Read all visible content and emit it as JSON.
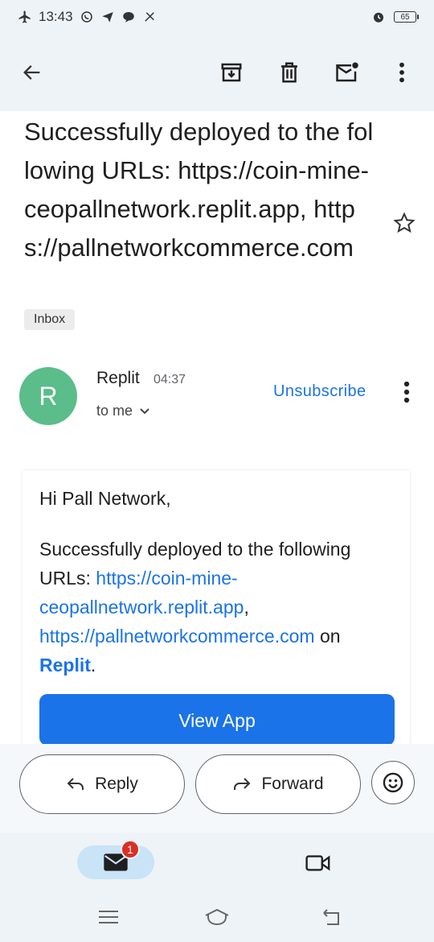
{
  "status_bar": {
    "time": "13:43",
    "battery": "65"
  },
  "toolbar": {
    "icons": [
      "back-arrow-icon",
      "archive-icon",
      "delete-icon",
      "mark-unread-icon",
      "more-vert-icon"
    ]
  },
  "email": {
    "subject": "Successfully deployed to the following URLs: https://coin-mine-ceopallnetwork.replit.app, https://pallnetworkcommerce.com",
    "label": "Inbox",
    "sender": {
      "initial": "R",
      "name": "Replit",
      "time": "04:37",
      "to": "to me"
    },
    "unsubscribe": "Unsubscribe",
    "body": {
      "greeting": "Hi Pall Network,",
      "text_before": "Successfully deployed to the following URLs: ",
      "link1": "https://coin-mine-ceopallnetwork.replit.app",
      "comma": ",",
      "link2": "https://pallnetworkcommerce.com",
      "on": " on ",
      "brand_link": "Replit",
      "period": ".",
      "button": "View App"
    }
  },
  "actions": {
    "reply": "Reply",
    "forward": "Forward"
  },
  "bottom_nav": {
    "mail_badge": "1"
  },
  "colors": {
    "accent": "#1a73e8",
    "avatar": "#5bbd8a",
    "badge": "#d93025"
  }
}
